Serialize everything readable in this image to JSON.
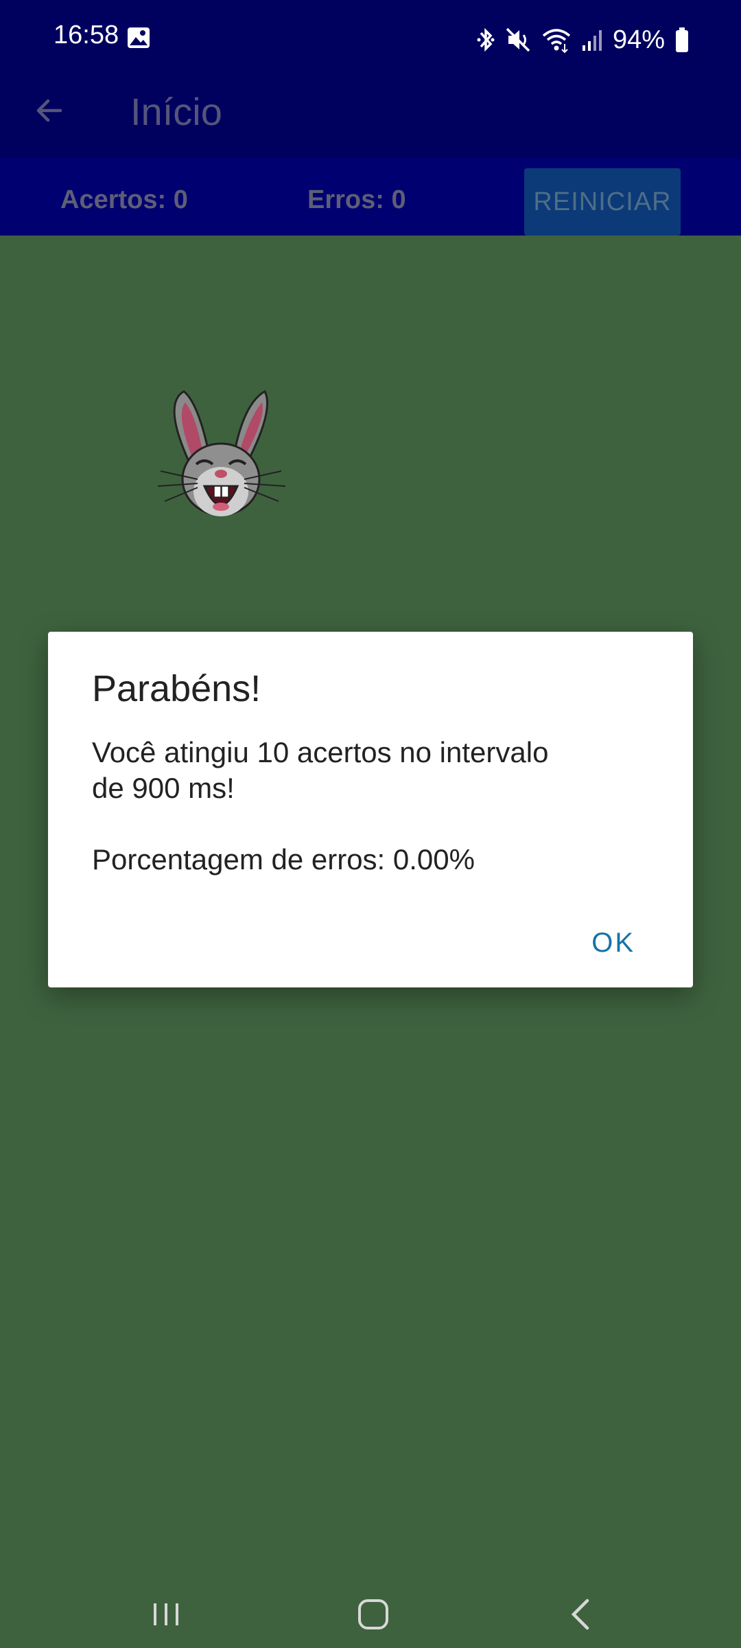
{
  "status_bar": {
    "time": "16:58",
    "battery_percent": "94%",
    "icons": [
      "image-icon",
      "bluetooth-icon",
      "mute-icon",
      "wifi-icon",
      "signal-icon",
      "battery-icon"
    ]
  },
  "app_bar": {
    "title": "Início",
    "back_icon": "arrow-back-icon"
  },
  "score_bar": {
    "acertos": "Acertos: 0",
    "erros": "Erros: 0",
    "restart_label": "REINICIAR"
  },
  "dialog": {
    "title": "Parabéns!",
    "message": "Você atingiu 10 acertos no intervalo\nde 900 ms!\n\nPorcentagem de erros: 0.00%",
    "ok_label": "OK"
  },
  "nav_bar": {
    "icons": [
      "recents-icon",
      "home-icon",
      "back-icon"
    ]
  },
  "colors": {
    "header": "#00005f",
    "score_bar": "#000070",
    "game_background": "#3e623e",
    "restart_button": "#0c3a78",
    "dialog_accent": "#1673a8"
  }
}
